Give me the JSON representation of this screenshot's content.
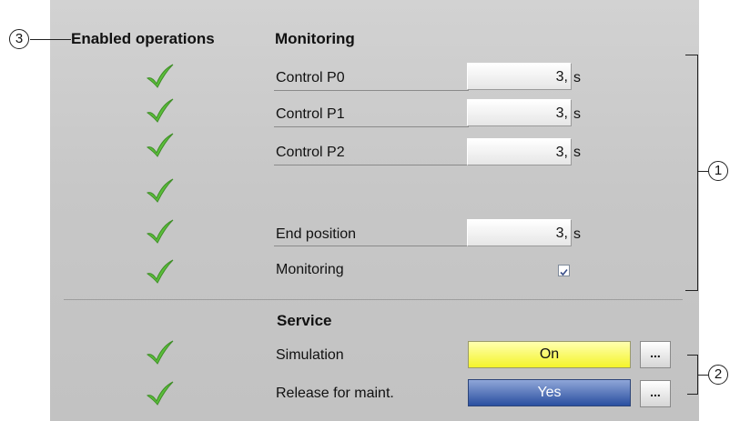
{
  "header": {
    "enabled_operations": "Enabled operations",
    "monitoring": "Monitoring"
  },
  "rows": {
    "control_p0": {
      "label": "Control P0",
      "value": "3,",
      "unit": "s"
    },
    "control_p1": {
      "label": "Control P1",
      "value": "3,",
      "unit": "s"
    },
    "control_p2": {
      "label": "Control P2",
      "value": "3,",
      "unit": "s"
    },
    "end_position": {
      "label": "End position",
      "value": "3,",
      "unit": "s"
    },
    "monitoring": {
      "label": "Monitoring",
      "checked": true
    }
  },
  "service": {
    "title": "Service",
    "simulation": {
      "label": "Simulation",
      "value": "On",
      "more": "..."
    },
    "release": {
      "label": "Release for maint.",
      "value": "Yes",
      "more": "..."
    }
  },
  "callouts": {
    "c1": "1",
    "c2": "2",
    "c3": "3"
  },
  "icons": {
    "enabled": "check-icon",
    "checkbox": "checkbox-checked-icon"
  },
  "colors": {
    "check": "#5bbf3a",
    "simulation_on": "#f4f42a",
    "release_yes": "#2a4fa0"
  }
}
